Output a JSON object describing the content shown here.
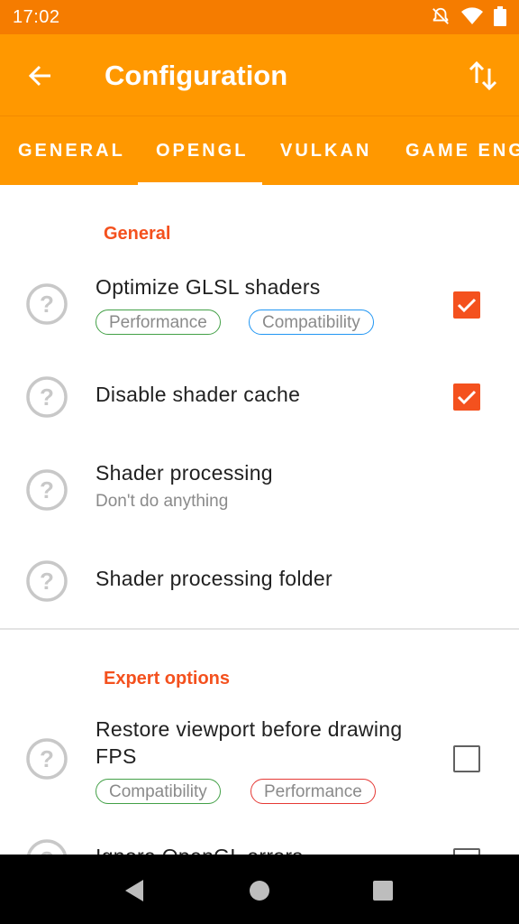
{
  "status": {
    "time": "17:02",
    "icons": [
      "do-not-disturb-off-icon",
      "wifi-icon",
      "battery-icon"
    ]
  },
  "appbar": {
    "title": "Configuration",
    "back_icon": "arrow-back-icon",
    "action_icon": "swap-vert-icon"
  },
  "tabs": [
    {
      "label": "GENERAL"
    },
    {
      "label": "OPENGL",
      "selected": true
    },
    {
      "label": "VULKAN"
    },
    {
      "label": "GAME ENG"
    }
  ],
  "sections": {
    "general": {
      "title": "General",
      "items": [
        {
          "label": "Optimize GLSL shaders",
          "tags": [
            "Performance",
            "Compatibility"
          ],
          "checked": true
        },
        {
          "label": "Disable shader cache",
          "checked": true
        },
        {
          "label": "Shader processing",
          "summary": "Don't do anything"
        },
        {
          "label": "Shader processing folder"
        }
      ]
    },
    "expert": {
      "title": "Expert options",
      "items": [
        {
          "label_line1": "Restore viewport before drawing",
          "label_line2": "FPS",
          "tags": [
            "Compatibility",
            "Performance"
          ],
          "checked": false
        },
        {
          "label": "Ignore OpenGL errors",
          "checked": false
        }
      ]
    }
  },
  "colors": {
    "status_bar": "#f57c00",
    "app_bar": "#ff9800",
    "accent": "#f4511e"
  }
}
